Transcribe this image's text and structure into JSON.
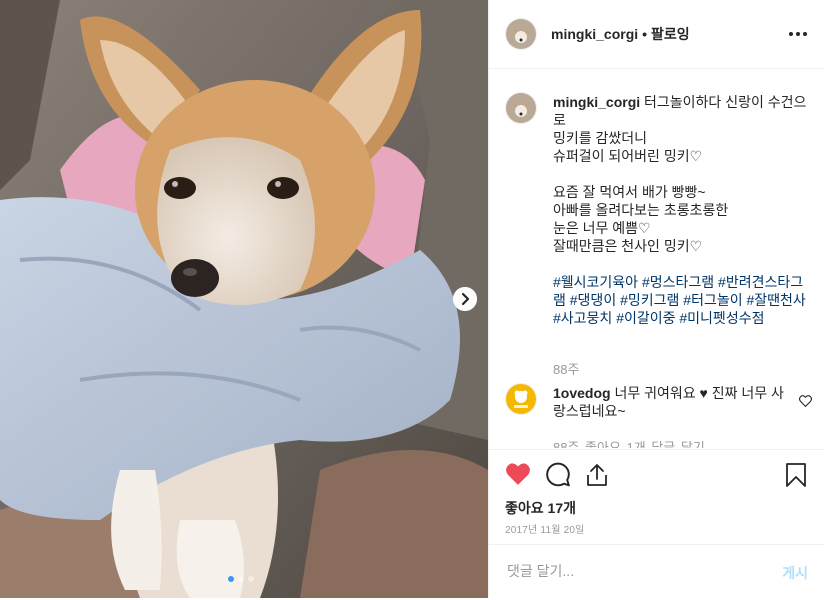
{
  "post": {
    "username": "mingki_corgi",
    "follow_separator": "•",
    "follow_label": "팔로잉",
    "caption_username": "mingki_corgi",
    "caption_body": "터그놀이하다 신랑이 수건으로\n밍키를 감쌌더니\n슈퍼걸이 되어버린 밍키♡\n\n요즘 잘 먹여서 배가 빵빵~\n아빠를 올려다보는 초롱초롱한\n눈은 너무 예쁨♡\n잘때만큼은 천사인 밍키♡\n\n",
    "caption_tags": "#웰시코기육아 #멍스타그램 #반려견스타그램 #댕댕이 #밍키그램 #터그놀이 #잘땐천사 #사고뭉치 #이갈이중 #미니펫성수점",
    "caption_age": "88주",
    "comment": {
      "username": "1ovedog",
      "text": "너무 귀여워요 ♥ 진짜 너무 사랑스럽네요~",
      "meta": "88주    좋아요 1개    답글 달기"
    },
    "likes_label": "좋아요 17개",
    "date": "2017년 11월 20일",
    "comment_placeholder": "댓글 달기...",
    "post_button": "게시"
  },
  "carousel": {
    "count": 3,
    "active_index": 0
  },
  "colors": {
    "liked_heart": "#ed4956",
    "accent_dot": "#3897f0",
    "hashtag": "#003569",
    "post_button_disabled": "#b2dffc"
  },
  "icons": [
    "more-options-icon",
    "next-arrow-icon",
    "heart-filled-icon",
    "comment-icon",
    "share-icon",
    "bookmark-icon",
    "small-heart-icon"
  ]
}
